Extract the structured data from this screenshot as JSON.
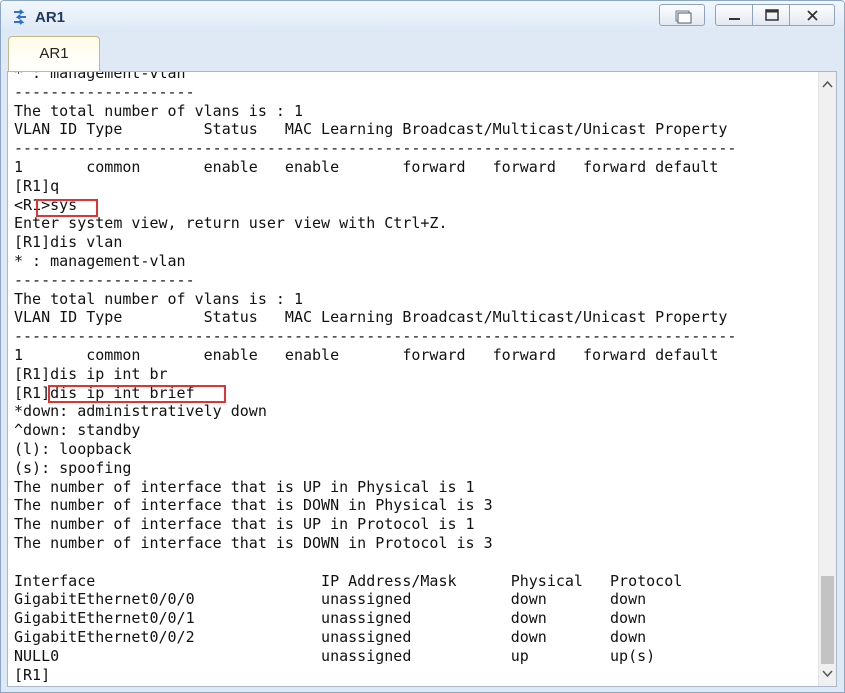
{
  "window": {
    "title": "AR1",
    "app_icon": "network-device-icon"
  },
  "tabs": [
    {
      "label": "AR1",
      "active": true
    }
  ],
  "terminal": {
    "lines": [
      "* : management-vlan",
      "--------------------",
      "The total number of vlans is : 1",
      "VLAN ID Type         Status   MAC Learning Broadcast/Multicast/Unicast Property",
      "--------------------------------------------------------------------------------",
      "1       common       enable   enable       forward   forward   forward default",
      "[R1]q",
      "<R1>sys",
      "Enter system view, return user view with Ctrl+Z.",
      "[R1]dis vlan",
      "* : management-vlan",
      "--------------------",
      "The total number of vlans is : 1",
      "VLAN ID Type         Status   MAC Learning Broadcast/Multicast/Unicast Property",
      "--------------------------------------------------------------------------------",
      "1       common       enable   enable       forward   forward   forward default",
      "[R1]dis ip int br",
      "[R1]dis ip int brief",
      "*down: administratively down",
      "^down: standby",
      "(l): loopback",
      "(s): spoofing",
      "The number of interface that is UP in Physical is 1",
      "The number of interface that is DOWN in Physical is 3",
      "The number of interface that is UP in Protocol is 1",
      "The number of interface that is DOWN in Protocol is 3",
      "",
      "Interface                         IP Address/Mask      Physical   Protocol",
      "GigabitEthernet0/0/0              unassigned           down       down",
      "GigabitEthernet0/0/1              unassigned           down       down",
      "GigabitEthernet0/0/2              unassigned           down       down",
      "NULL0                             unassigned           up         up(s)",
      "[R1]"
    ]
  },
  "colors": {
    "highlight": "#e03434"
  }
}
